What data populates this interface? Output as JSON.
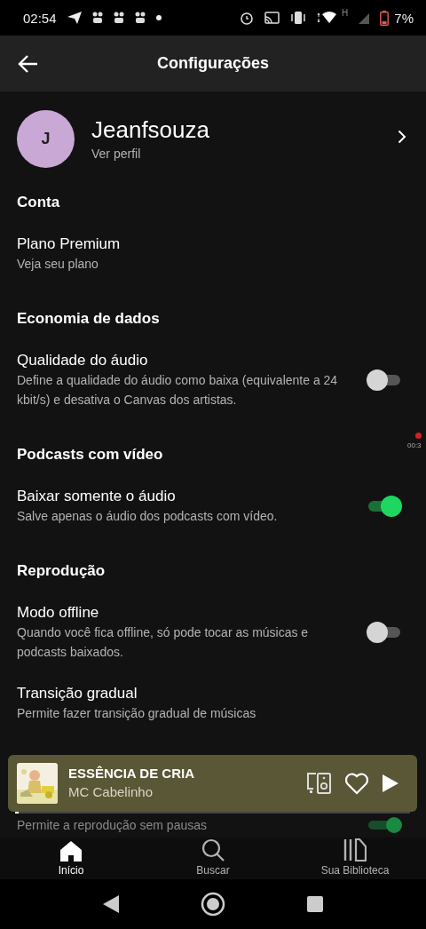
{
  "status_bar": {
    "time": "02:54",
    "battery": "7%",
    "network": "H"
  },
  "header": {
    "title": "Configurações"
  },
  "recording": {
    "time": "00:3"
  },
  "profile": {
    "initial": "J",
    "name": "Jeanfsouza",
    "subtitle": "Ver perfil"
  },
  "settings": [
    {
      "kind": "section",
      "title": "Conta"
    },
    {
      "kind": "link",
      "title": "Plano Premium",
      "subtitle": "Veja seu plano"
    },
    {
      "kind": "section",
      "title": "Economia de dados"
    },
    {
      "kind": "toggle",
      "title": "Qualidade do áudio",
      "subtitle": "Define a qualidade do áudio como baixa (equivalente a 24 kbit/s) e desativa o Canvas dos artistas.",
      "on": false
    },
    {
      "kind": "section",
      "title": "Podcasts com vídeo"
    },
    {
      "kind": "toggle",
      "title": "Baixar somente o áudio",
      "subtitle": "Salve apenas o áudio dos podcasts com vídeo.",
      "on": true
    },
    {
      "kind": "section",
      "title": "Reprodução"
    },
    {
      "kind": "toggle",
      "title": "Modo offline",
      "subtitle": "Quando você fica offline, só pode tocar as músicas e podcasts baixados.",
      "on": false
    },
    {
      "kind": "link",
      "title": "Transição gradual",
      "subtitle": "Permite fazer transição gradual de músicas"
    },
    {
      "kind": "toggle",
      "subtitle": "Permite a reprodução sem pausas",
      "on": true
    }
  ],
  "player": {
    "title": "ESSÊNCIA DE CRIA",
    "artist": "MC Cabelinho",
    "liked": false,
    "level": 0.01
  },
  "tabs": [
    {
      "label": "Início",
      "selected": true
    },
    {
      "label": "Buscar",
      "selected": false
    },
    {
      "label": "Sua Biblioteca",
      "selected": false
    }
  ]
}
